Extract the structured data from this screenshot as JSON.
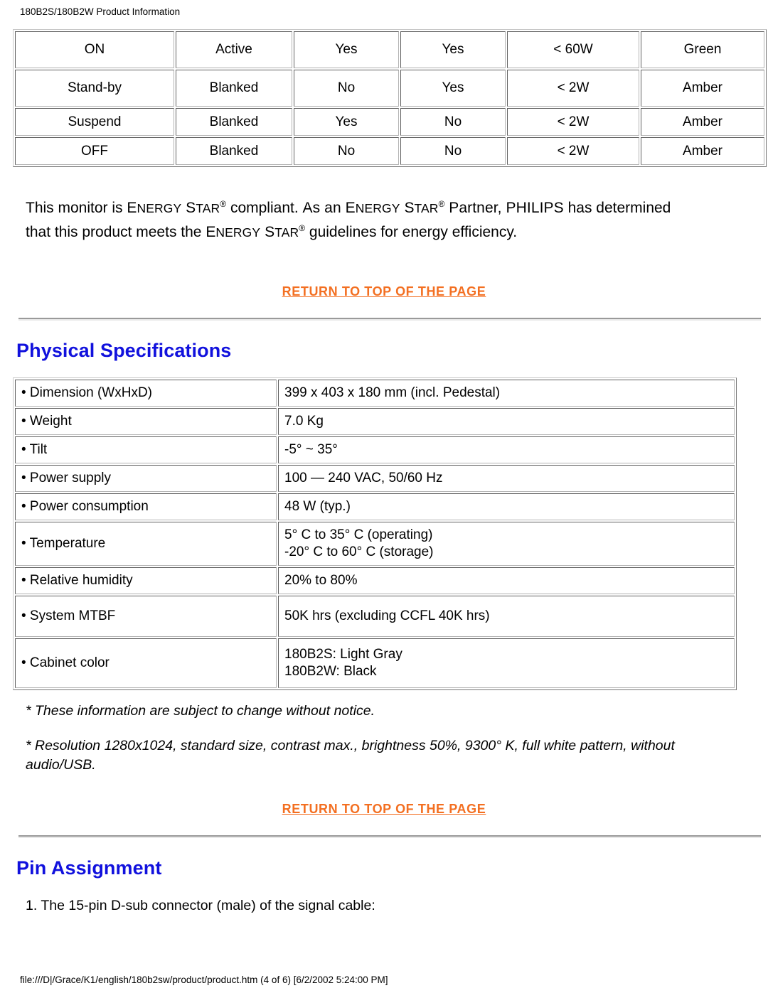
{
  "header": {
    "title": "180B2S/180B2W Product Information"
  },
  "power_table": {
    "rows": [
      {
        "mode": "ON",
        "video": "Active",
        "hsync": "Yes",
        "vsync": "Yes",
        "power": "< 60W",
        "led": "Green"
      },
      {
        "mode": "Stand-by",
        "video": "Blanked",
        "hsync": "No",
        "vsync": "Yes",
        "power": "< 2W",
        "led": "Amber"
      },
      {
        "mode": "Suspend",
        "video": "Blanked",
        "hsync": "Yes",
        "vsync": "No",
        "power": "< 2W",
        "led": "Amber"
      },
      {
        "mode": "OFF",
        "video": "Blanked",
        "hsync": "No",
        "vsync": "No",
        "power": "< 2W",
        "led": "Amber"
      }
    ]
  },
  "energy_star": {
    "part1": "This monitor is ",
    "brand1_cap": "E",
    "brand1_small": "NERGY",
    "brand1_cap2": "S",
    "brand1_small2": "TAR",
    "part2": " compliant. ",
    "as_cap": "A",
    "as_small": "s an ",
    "brand2_cap": "E",
    "brand2_small": "NERGY",
    "brand2_cap2": "S",
    "brand2_small2": "TAR",
    "part3": " ",
    "partner_cap": "P",
    "partner_small": "artner, ",
    "philips_cap": "PHILIPS",
    "part4": " has determined that this product meets the ",
    "brand3_cap": "E",
    "brand3_small": "NERGY",
    "brand3_cap2": "S",
    "brand3_small2": "TAR",
    "part5": " guidelines for energy efficiency."
  },
  "links": {
    "return_top_1": "RETURN TO TOP OF THE PAGE",
    "return_top_2": "RETURN TO TOP OF THE PAGE"
  },
  "sections": {
    "physical_specifications": "Physical Specifications",
    "pin_assignment": "Pin Assignment"
  },
  "spec_table": {
    "rows": [
      {
        "key": "• Dimension (WxHxD)",
        "value": "399 x 403 x 180 mm (incl. Pedestal)"
      },
      {
        "key": "• Weight",
        "value": "7.0 Kg"
      },
      {
        "key": "• Tilt",
        "value": "-5° ~ 35°"
      },
      {
        "key": "• Power supply",
        "value": "100 — 240 VAC, 50/60 Hz"
      },
      {
        "key": "• Power consumption",
        "value": "48 W (typ.)"
      },
      {
        "key": "• Temperature",
        "value_line1": "5° C to 35° C (operating)",
        "value_line2": "-20° C to 60° C (storage)"
      },
      {
        "key": "• Relative humidity",
        "value": "20% to 80%"
      },
      {
        "key": "• System MTBF",
        "value": "50K hrs (excluding CCFL 40K hrs)"
      },
      {
        "key": "• Cabinet color",
        "value_line1": "180B2S: Light Gray",
        "value_line2": "180B2W: Black"
      }
    ]
  },
  "notes": {
    "note1": "* These information are subject to change without notice.",
    "note2": "* Resolution 1280x1024, standard size, contrast max., brightness 50%, 9300° K, full white pattern, without audio/USB."
  },
  "pin": {
    "intro": "1. The 15-pin D-sub connector (male) of the signal cable:"
  },
  "footer": {
    "path": "file:///D|/Grace/K1/english/180b2sw/product/product.htm (4 of 6) [6/2/2002 5:24:00 PM]"
  },
  "colors": {
    "link_orange": "#f36f21",
    "heading_blue": "#1111dd"
  }
}
